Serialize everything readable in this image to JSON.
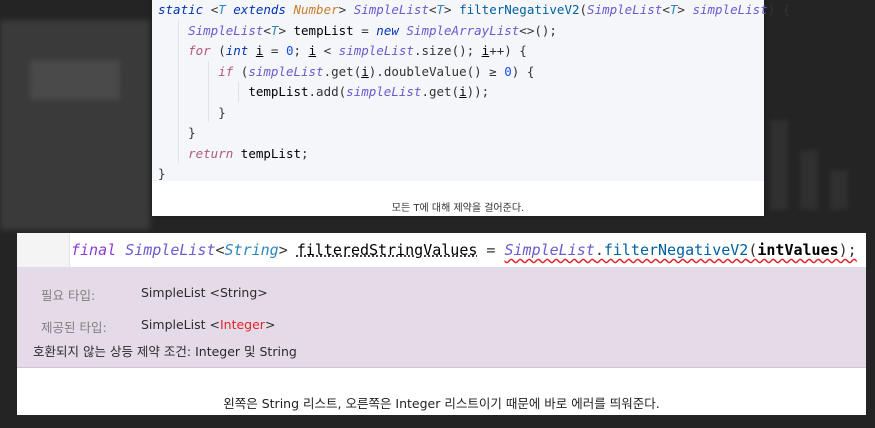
{
  "top_code": {
    "lines": [
      {
        "parts": [
          [
            "static ",
            "k"
          ],
          [
            "<",
            "p"
          ],
          [
            "T",
            "t"
          ],
          [
            " extends ",
            "k"
          ],
          [
            "Number",
            "tn"
          ],
          [
            "> ",
            "p"
          ],
          [
            "SimpleList",
            "cls"
          ],
          [
            "<",
            "p"
          ],
          [
            "T",
            "t"
          ],
          [
            "> ",
            "p"
          ],
          [
            "filterNegativeV2",
            "m"
          ],
          [
            "(",
            "p"
          ],
          [
            "SimpleList",
            "cls"
          ],
          [
            "<",
            "p"
          ],
          [
            "T",
            "t"
          ],
          [
            "> ",
            "p"
          ],
          [
            "simpleList",
            "cls"
          ],
          [
            ") {",
            "p"
          ]
        ]
      },
      {
        "parts": [
          [
            "    ",
            "p"
          ],
          [
            "SimpleList",
            "cls"
          ],
          [
            "<",
            "p"
          ],
          [
            "T",
            "t"
          ],
          [
            "> ",
            "p"
          ],
          [
            "tempList",
            "d"
          ],
          [
            " = ",
            "p"
          ],
          [
            "new ",
            "k"
          ],
          [
            "SimpleArrayList",
            "cls"
          ],
          [
            "<>();",
            "p"
          ]
        ]
      },
      {
        "parts": [
          [
            "    ",
            "p"
          ],
          [
            "for ",
            "kw"
          ],
          [
            "(",
            "p"
          ],
          [
            "int ",
            "k"
          ],
          [
            "i",
            "du"
          ],
          [
            " = ",
            "p"
          ],
          [
            "0",
            "n"
          ],
          [
            "; ",
            "p"
          ],
          [
            "i",
            "du"
          ],
          [
            " < ",
            "p"
          ],
          [
            "simpleList",
            "cls"
          ],
          [
            ".size(); ",
            "p"
          ],
          [
            "i",
            "du"
          ],
          [
            "++) {",
            "p"
          ]
        ]
      },
      {
        "parts": [
          [
            "        ",
            "p"
          ],
          [
            "if ",
            "kw"
          ],
          [
            "(",
            "p"
          ],
          [
            "simpleList",
            "cls"
          ],
          [
            ".get(",
            "p"
          ],
          [
            "i",
            "du"
          ],
          [
            ").doubleValue() ≥ ",
            "p"
          ],
          [
            "0",
            "n"
          ],
          [
            ") {",
            "p"
          ]
        ]
      },
      {
        "parts": [
          [
            "            ",
            "p"
          ],
          [
            "tempList",
            "d"
          ],
          [
            ".add(",
            "p"
          ],
          [
            "simpleList",
            "cls"
          ],
          [
            ".get(",
            "p"
          ],
          [
            "i",
            "du"
          ],
          [
            "));",
            "p"
          ]
        ]
      },
      {
        "parts": [
          [
            "        }",
            "p"
          ]
        ]
      },
      {
        "parts": [
          [
            "    }",
            "p"
          ]
        ]
      },
      {
        "parts": [
          [
            "    ",
            "p"
          ],
          [
            "return ",
            "kw"
          ],
          [
            "tempList",
            "d"
          ],
          [
            ";",
            "p"
          ]
        ]
      },
      {
        "parts": [
          [
            "}",
            "p"
          ]
        ]
      }
    ],
    "caption": "모든 T에 대해 제약을 걸어준다."
  },
  "error_card": {
    "code_parts": [
      [
        "final ",
        "kwp2"
      ],
      [
        "SimpleList",
        "cls2"
      ],
      [
        "<",
        "p2"
      ],
      [
        "String",
        "str2"
      ],
      [
        "> ",
        "p2"
      ],
      [
        "filteredStringValues",
        "var2"
      ],
      [
        " = ",
        "p2"
      ],
      [
        "SimpleList",
        "cls2"
      ],
      [
        ".",
        "p2"
      ],
      [
        "filterNegativeV2",
        "m2"
      ],
      [
        "(",
        "p2"
      ],
      [
        "intValues",
        "d2"
      ],
      [
        ");",
        "p2"
      ]
    ],
    "required_label": "필요 타입:",
    "required_value": "SimpleList <String>",
    "provided_label": "제공된 타입:",
    "provided_value_prefix": "SimpleList <",
    "provided_value_type": "Integer",
    "provided_value_suffix": ">",
    "incompatible_text": "호환되지 않는 상등 제약 조건: Integer 및 String",
    "caption": "왼쪽은 String 리스트, 오른쪽은 Integer 리스트이기 때문에 바로 에러를 띄워준다."
  },
  "colors": {
    "background": "#242424",
    "error_panel": "#e5dbe8",
    "error_red": "#e0242a"
  }
}
